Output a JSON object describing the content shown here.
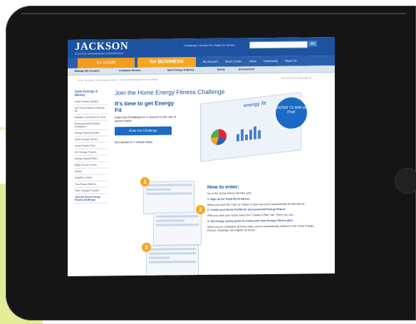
{
  "site": {
    "logo": "JACKSON",
    "logo_sub": "ELECTRIC MEMBERSHIP CORPORATION",
    "top_links": "Homepage | Contact Us | Apply for Service",
    "search_placeholder": "",
    "go_label": "GO"
  },
  "tabs": {
    "home": "for HOME",
    "business": "for BUSINESS",
    "nav": [
      "My Account",
      "Storm Center",
      "News",
      "Community",
      "About Us"
    ]
  },
  "subnav": [
    "Manage My Account",
    "Customer Service",
    "Save Energy & Money",
    "Safety",
    "Environment"
  ],
  "breadcrumb": "Home › for Home › Save Energy & Money › Join the Home Energy Fitness Challenge",
  "tools": "Text Size A A A  ✉ Share  🖶 Print",
  "sidebar": {
    "title": "Save Energy & Money",
    "items": [
      "Home Fitness Monitor",
      "DIY Home Fitness Checkup Kit",
      "Rebates, Incentives & Loans",
      "Personal Home Fitness Evaluation",
      "Energy Fitness Guides",
      "Home Energy Library",
      "Home Fitness Plan",
      "DIY Energy Projects",
      "Energy Saving Rates",
      "Right Choice Homes",
      "Vektra",
      "ENERGY STAR",
      "Your Power Matters",
      "Filter Change Program",
      "Join the Home Energy Fitness Challenge"
    ]
  },
  "main": {
    "title": "Join the Home Energy Fitness Challenge",
    "promo_heading": "It's time to get Energy Fit",
    "promo_text": "Enter the Challenge for a chance to win one of seven iPads!",
    "cta": "Enter the Challenge",
    "steps_note": "Get started in 3 simple steps.",
    "hero_logo": "energy fit",
    "badge": "ENTER TO WIN an iPad!",
    "howto_title": "How to enter:",
    "howto_intro": "Go to the Home Fitness Monitor and...",
    "steps": [
      {
        "link": "1. Sign up for Track My Progress.",
        "text": "When you click the \"sign up\" button in step one you'll automatically be directed to..."
      },
      {
        "link": "2. Create your Home Profile for your personal Energy Report.",
        "text": "After you view your report select the \"Create A Plan\" tab. There you can..."
      },
      {
        "link": "3. Set energy saving goals to create your own Energy Fitness plan.",
        "text": "When you've completed all three steps, you're automatically entered in the Home Energy Fitness Challenge and eligible for prizes."
      }
    ],
    "numbers": [
      "1",
      "2",
      "3"
    ]
  }
}
